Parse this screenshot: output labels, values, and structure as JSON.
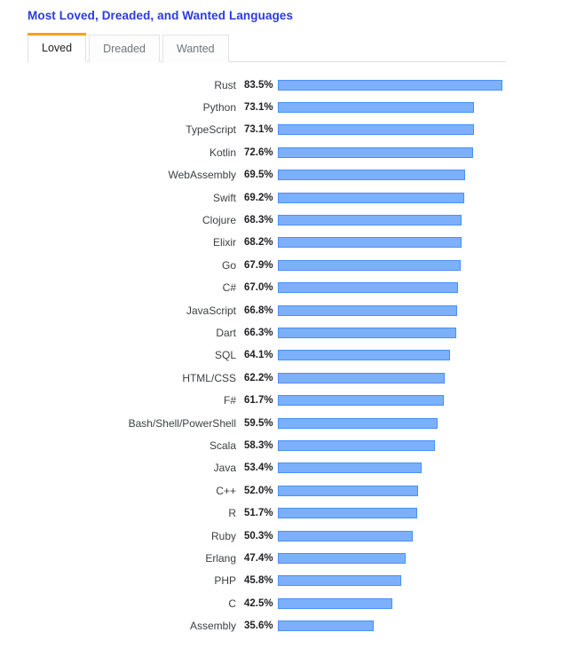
{
  "header": {
    "title": "Most Loved, Dreaded, and Wanted Languages"
  },
  "tabs": [
    {
      "label": "Loved",
      "active": true
    },
    {
      "label": "Dreaded",
      "active": false
    },
    {
      "label": "Wanted",
      "active": false
    }
  ],
  "chart_data": {
    "type": "bar",
    "orientation": "horizontal",
    "title": "Most Loved, Dreaded, and Wanted Languages",
    "xlabel": "",
    "ylabel": "",
    "xlim": [
      0,
      100
    ],
    "grid": false,
    "legend": "none",
    "value_suffix": "%",
    "bar_fill": "#7cb0fb",
    "bar_border": "#4a90f7",
    "categories": [
      "Rust",
      "Python",
      "TypeScript",
      "Kotlin",
      "WebAssembly",
      "Swift",
      "Clojure",
      "Elixir",
      "Go",
      "C#",
      "JavaScript",
      "Dart",
      "SQL",
      "HTML/CSS",
      "F#",
      "Bash/Shell/PowerShell",
      "Scala",
      "Java",
      "C++",
      "R",
      "Ruby",
      "Erlang",
      "PHP",
      "C",
      "Assembly"
    ],
    "values": [
      83.5,
      73.1,
      73.1,
      72.6,
      69.5,
      69.2,
      68.3,
      68.2,
      67.9,
      67.0,
      66.8,
      66.3,
      64.1,
      62.2,
      61.7,
      59.5,
      58.3,
      53.4,
      52.0,
      51.7,
      50.3,
      47.4,
      45.8,
      42.5,
      35.6
    ],
    "value_labels": [
      "83.5%",
      "73.1%",
      "73.1%",
      "72.6%",
      "69.5%",
      "69.2%",
      "68.3%",
      "68.2%",
      "67.9%",
      "67.0%",
      "66.8%",
      "66.3%",
      "64.1%",
      "62.2%",
      "61.7%",
      "59.5%",
      "58.3%",
      "53.4%",
      "52.0%",
      "51.7%",
      "50.3%",
      "47.4%",
      "45.8%",
      "42.5%",
      "35.6%"
    ]
  }
}
